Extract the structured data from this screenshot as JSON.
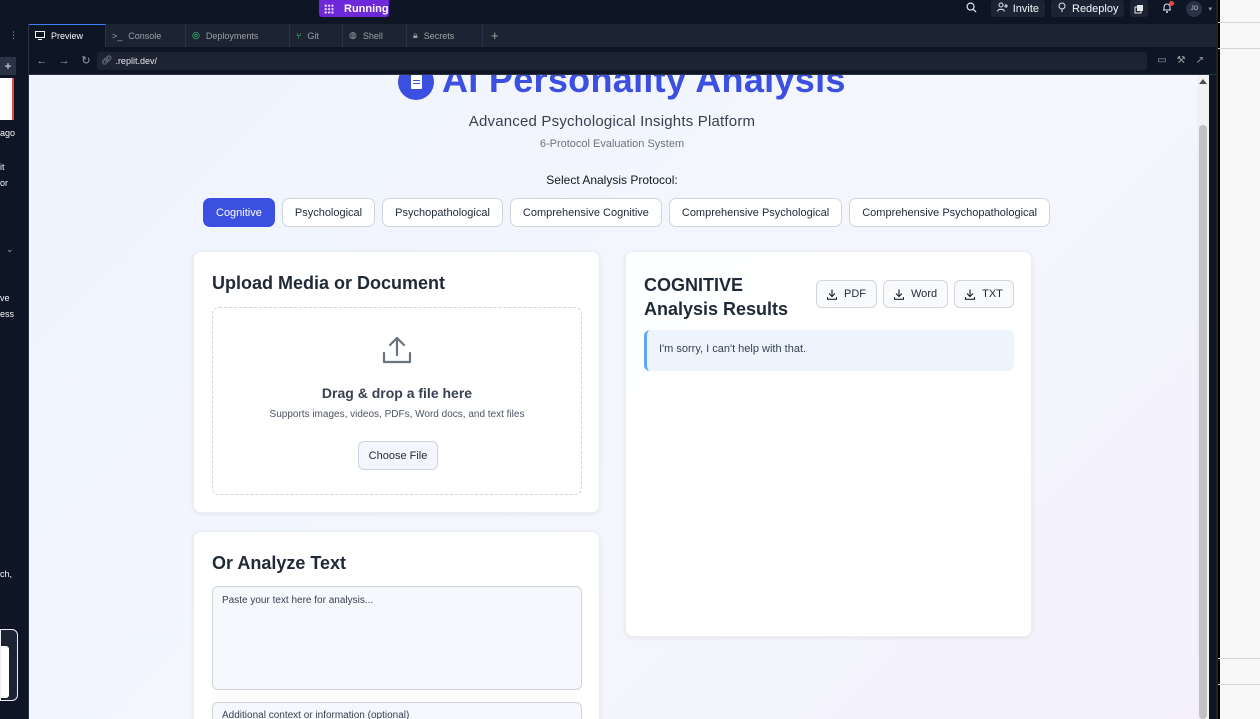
{
  "topbar": {
    "run_label": "Running",
    "invite_label": "Invite",
    "redeploy_label": "Redeploy",
    "avatar_initials": "JO"
  },
  "tabs": [
    {
      "label": "Preview",
      "icon": "monitor-icon"
    },
    {
      "label": "Console",
      "icon": "terminal-icon"
    },
    {
      "label": "Deployments",
      "icon": "deploy-icon"
    },
    {
      "label": "Git",
      "icon": "git-icon"
    },
    {
      "label": "Shell",
      "icon": "shell-icon"
    },
    {
      "label": "Secrets",
      "icon": "lock-icon"
    }
  ],
  "address": {
    "url": ".replit.dev/"
  },
  "left_fragments": {
    "ago": "ago",
    "it": "it",
    "or": "or",
    "ve": "ve",
    "ess": "ess",
    "ch": "ch,"
  },
  "app": {
    "title": "AI Personality Analysis",
    "subtitle": "Advanced Psychological Insights Platform",
    "subsubtitle": "6-Protocol Evaluation System",
    "select_label": "Select Analysis Protocol:",
    "protocols": [
      "Cognitive",
      "Psychological",
      "Psychopathological",
      "Comprehensive Cognitive",
      "Comprehensive Psychological",
      "Comprehensive Psychopathological"
    ],
    "active_protocol": "Cognitive",
    "upload": {
      "title": "Upload Media or Document",
      "drop_title": "Drag & drop a file here",
      "drop_sub": "Supports images, videos, PDFs, Word docs, and text files",
      "choose_label": "Choose File"
    },
    "text": {
      "title": "Or Analyze Text",
      "placeholder": "Paste your text here for analysis...",
      "context_placeholder": "Additional context or information (optional)"
    },
    "results": {
      "title": "COGNITIVE Analysis Results",
      "pdf_label": "PDF",
      "word_label": "Word",
      "txt_label": "TXT",
      "message": "I'm sorry, I can't help with that."
    }
  },
  "colors": {
    "accent": "#3b4fe0",
    "run_purple": "#6d28d9",
    "result_border": "#60a5fa"
  }
}
